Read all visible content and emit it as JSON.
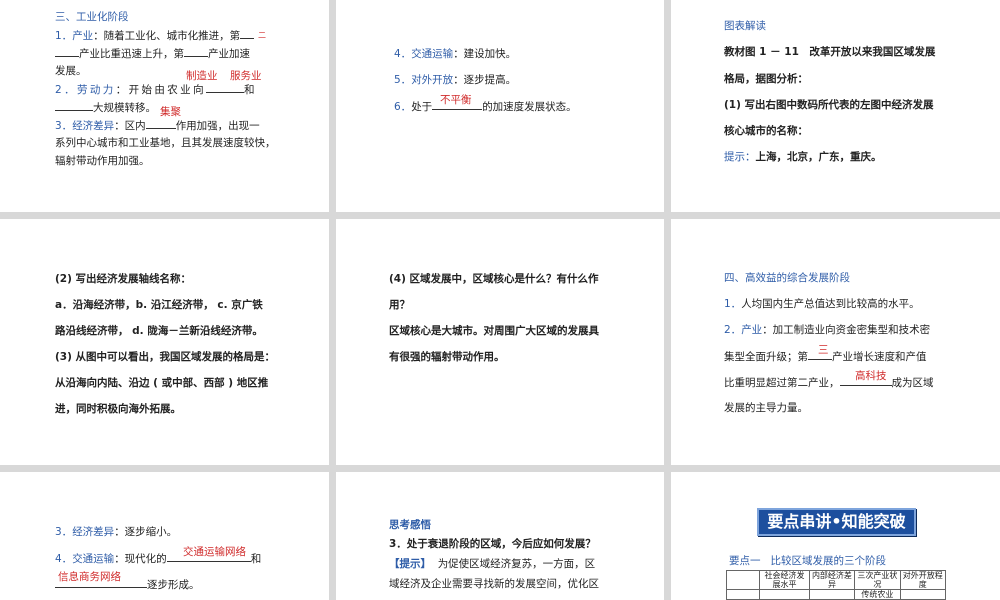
{
  "s1": {
    "heading": "三、工业化阶段",
    "l1a_num": "1．",
    "l1a_key": "产业",
    "l1a_text": "：随着工业化、城市化推进，第",
    "l1b_text": "产业比重迅速上升，第",
    "l1b_tail": "产业加速",
    "l1c_text": "发展。",
    "ans_small": "二",
    "ans_mfg": "制造业",
    "ans_svc": "服务业",
    "l2a_num": "2．",
    "l2a_key": "劳动力",
    "l2a_text": "：开始由农业向",
    "l2a_tail": "和",
    "l2b_text": "大规模转移。",
    "ans_cluster": "集聚",
    "l3a_num": "3．",
    "l3a_key": "经济差异",
    "l3a_text": "：区内",
    "l3a_tail": "作用加强，出现一",
    "l3b_text": "系列中心城市和工业基地，且其发展速度较快，",
    "l3c_text": "辐射带动作用加强。"
  },
  "s2": {
    "l4_num": "4．",
    "l4_key": "交通运输",
    "l4_text": "：建设加快。",
    "l5_num": "5．",
    "l5_key": "对外开放",
    "l5_text": "：逐步提高。",
    "l6_num": "6．",
    "l6_text": "处于",
    "l6_ans": "不平衡",
    "l6_tail": "的加速度发展状态。"
  },
  "s3": {
    "title": "图表解读",
    "l1": "教材图 1 － 11　改革开放以来我国区域发展",
    "l2": "格局，据图分析：",
    "l3": "(1) 写出右图中数码所代表的左图中经济发展",
    "l4": "核心城市的名称：",
    "hint_label": "提示：",
    "hint_text": "上海，北京，广东，重庆。"
  },
  "s4": {
    "l1": "(2) 写出经济发展轴线名称：",
    "l2": "a．沿海经济带，b. 沿江经济带， c. 京广铁",
    "l3": "路沿线经济带，  d. 陇海－兰新沿线经济带。",
    "l4": "(3) 从图中可以看出，我国区域发展的格局是：",
    "l5": "从沿海向内陆、沿边 ( 或中部、西部 ) 地区推",
    "l6": "进，同时积极向海外拓展。"
  },
  "s5": {
    "l1": "(4) 区域发展中，区域核心是什么？有什么作",
    "l2": "用？",
    "l3": "区域核心是大城市。对周围广大区域的发展具",
    "l4": "有很强的辐射带动作用。"
  },
  "s6": {
    "heading": "四、高效益的综合发展阶段",
    "l1_num": "1．",
    "l1_text": "人均国内生产总值达到比较高的水平。",
    "l2_num": "2．",
    "l2_key": "产业",
    "l2_text": "：加工制造业向资金密集型和技术密",
    "l3_text": "集型全面升级；第",
    "l3_ans": "三",
    "l3_tail": "产业增长速度和产值",
    "l4_text": "比重明显超过第二产业，",
    "l4_ans": "高科技",
    "l4_tail": "成为区域",
    "l5_text": "发展的主导力量。"
  },
  "s7": {
    "l3_num": "3．",
    "l3_key": "经济差异",
    "l3_text": "：逐步缩小。",
    "l4_num": "4．",
    "l4_key": "交通运输",
    "l4_text": "：现代化的",
    "l4_ans": "交通运输网络",
    "l4_tail": "和",
    "l5_ans": "信息商务网络",
    "l5_tail": "逐步形成。"
  },
  "s8": {
    "title": "思考感悟",
    "q": "3．处于衰退阶段的区域，今后应如何发展？",
    "hint_label": "【提示】",
    "hint_l1": "为促使区域经济复苏，一方面，区",
    "hint_l2": "域经济及企业需要寻找新的发展空间，优化区"
  },
  "s9": {
    "banner": "要点串讲•知能突破",
    "point_label": "要点一",
    "point_title": "比较区域发展的三个阶段",
    "table_headers": [
      "社会经济发展水平",
      "内部经济差异",
      "三次产业状况",
      "对外开放程度"
    ],
    "table_partial": "传统农业"
  }
}
